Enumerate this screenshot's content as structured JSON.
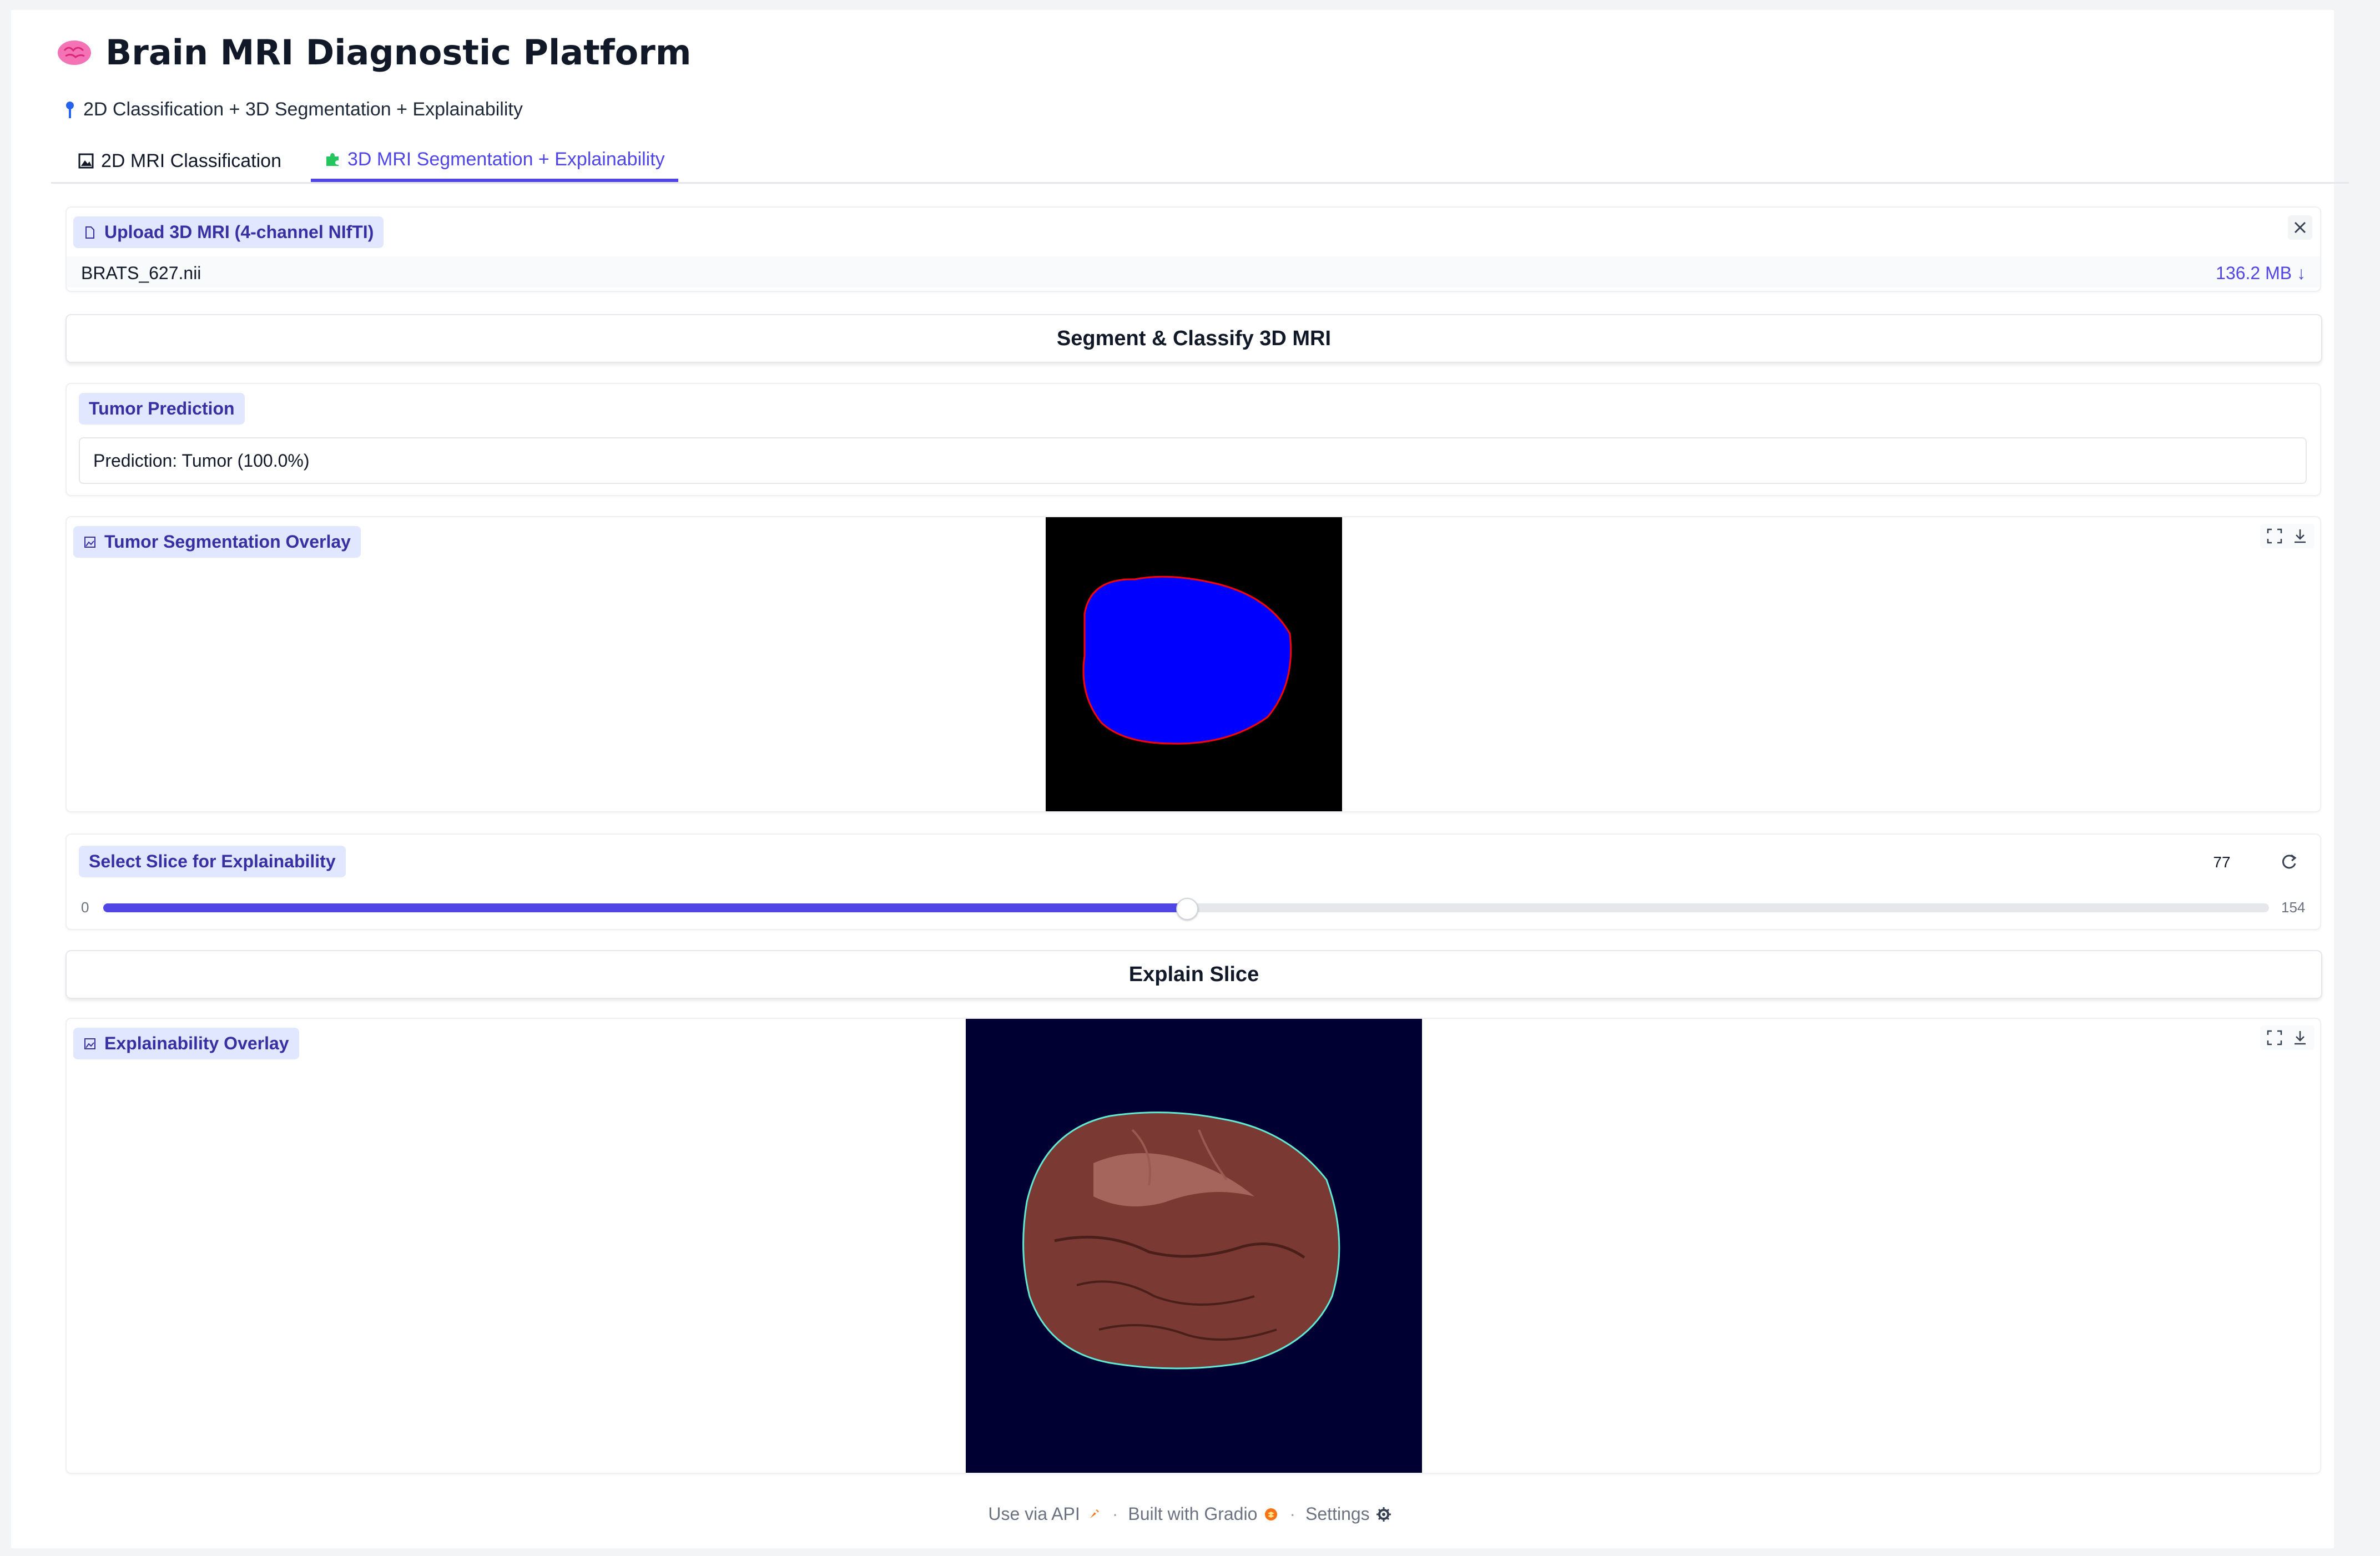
{
  "header": {
    "title": "Brain MRI Diagnostic Platform",
    "brain_icon": "brain-icon",
    "subtitle": "2D Classification + 3D Segmentation + Explainability",
    "subtitle_icon": "pin-icon"
  },
  "tabs": [
    {
      "label": "2D MRI Classification",
      "icon": "frame-icon",
      "active": false
    },
    {
      "label": "3D MRI Segmentation + Explainability",
      "icon": "puzzle-icon",
      "active": true
    }
  ],
  "upload": {
    "label": "Upload 3D MRI (4-channel NIfTI)",
    "file_name": "BRATS_627.nii",
    "file_size": "136.2 MB ↓"
  },
  "segment_button": "Segment & Classify 3D MRI",
  "prediction": {
    "label": "Tumor Prediction",
    "text": "Prediction: Tumor (100.0%)"
  },
  "segmentation_overlay": {
    "label": "Tumor Segmentation Overlay"
  },
  "slider": {
    "label": "Select Slice for Explainability",
    "value": "77",
    "min": "0",
    "max": "154",
    "fraction": 0.5
  },
  "explain_button": "Explain Slice",
  "explainability_overlay": {
    "label": "Explainability Overlay"
  },
  "footer": {
    "api": "Use via API",
    "built": "Built with Gradio",
    "settings": "Settings",
    "separator": "·"
  },
  "colors": {
    "accent": "#4f46e5",
    "chip_bg": "#e0e7ff",
    "chip_text": "#3730a3",
    "segmentation_fill": "#0000ff",
    "segmentation_edge": "#ff0000",
    "explain_bg": "#000033",
    "explain_tissue": "#7a3a33"
  }
}
